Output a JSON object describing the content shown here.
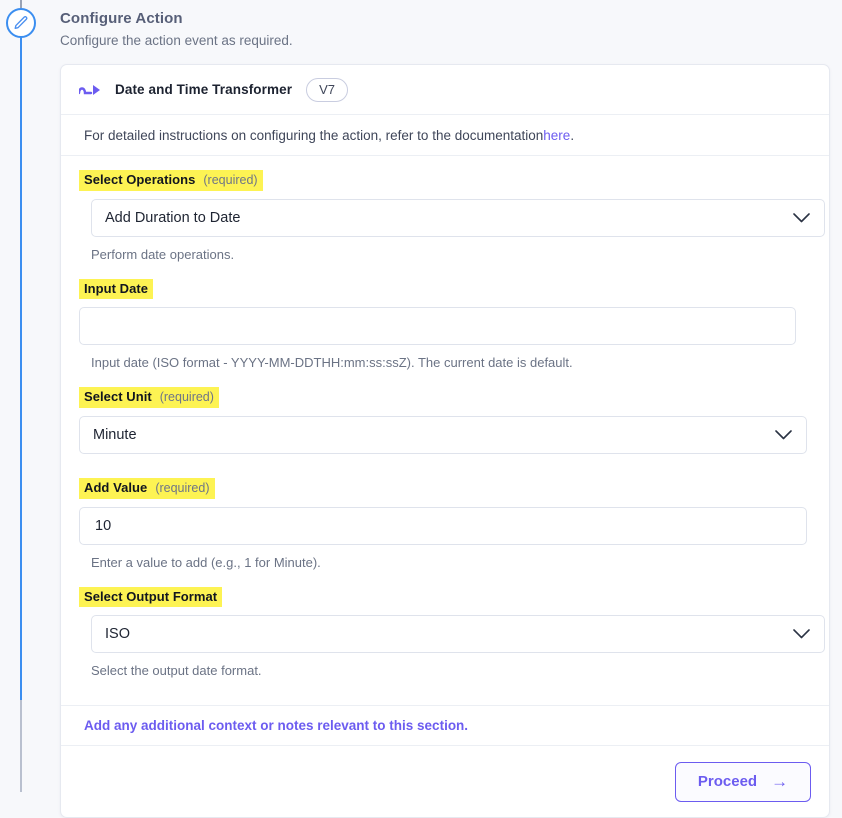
{
  "rail": {
    "node_icon": "pencil-icon",
    "line_color_active": "#3b8ef0",
    "line_color_inactive": "#b9c0cf"
  },
  "header": {
    "title": "Configure Action",
    "subtitle": "Configure the action event as required."
  },
  "card": {
    "icon": "transformer-arrow-icon",
    "title": "Date and Time Transformer",
    "version": "V7",
    "note": {
      "text_before": "For detailed instructions on configuring the action, refer to the documentation ",
      "link_label": "here",
      "text_after": "."
    },
    "fields": [
      {
        "label": "Select Operations",
        "required_tag": "(required)",
        "type": "select",
        "value": "Add Duration to Date",
        "help": "Perform date operations.",
        "chevron_icon": "chevron-down-icon"
      },
      {
        "label": "Input Date",
        "required_tag": "",
        "type": "text",
        "value": "",
        "placeholder": "",
        "help": "Input date (ISO format - YYYY-MM-DDTHH:mm:ss:ssZ). The current date is default."
      },
      {
        "label": "Select Unit",
        "required_tag": "(required)",
        "type": "select",
        "value": "Minute",
        "help": "",
        "chevron_icon": "chevron-down-icon"
      },
      {
        "label": "Add Value",
        "required_tag": "(required)",
        "type": "text",
        "value": "10",
        "placeholder": "",
        "help": "Enter a value to add (e.g., 1 for Minute)."
      },
      {
        "label": "Select Output Format",
        "required_tag": "",
        "type": "select",
        "value": "ISO",
        "help": "Select the output date format.",
        "chevron_icon": "chevron-down-icon"
      }
    ],
    "notes_link": "Add any additional context or notes relevant to this section.",
    "footer": {
      "proceed_label": "Proceed",
      "proceed_arrow": "→"
    }
  },
  "colors": {
    "highlight": "#fdf353",
    "accent_purple": "#6c5cf0",
    "rail_blue": "#3b8ef0",
    "page_bg": "#f7f8fb"
  }
}
